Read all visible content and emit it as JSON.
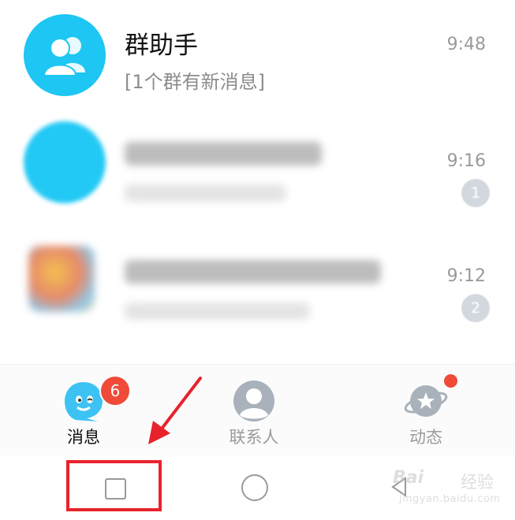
{
  "chat_list": {
    "items": [
      {
        "name": "群助手",
        "preview": "[1个群有新消息]",
        "time": "9:48",
        "unread": ""
      },
      {
        "name": "",
        "preview": "",
        "time": "9:16",
        "unread": "1"
      },
      {
        "name": "",
        "preview": "",
        "time": "9:12",
        "unread": "2"
      }
    ]
  },
  "tab_bar": {
    "tabs": [
      {
        "label": "消息",
        "badge": "6",
        "active": true
      },
      {
        "label": "联系人",
        "badge": "",
        "active": false
      },
      {
        "label": "动态",
        "badge": "dot",
        "active": false
      }
    ]
  },
  "nav_bar": {
    "buttons": [
      "recents-square-icon",
      "home-circle-icon",
      "back-triangle-icon"
    ]
  },
  "watermark": {
    "logo": "Bai",
    "name": "经验",
    "url": "jingyan.baidu.com"
  },
  "colors": {
    "accent_blue": "#1ec6f3",
    "badge_red": "#f04a38",
    "highlight_red": "#e8222b"
  }
}
